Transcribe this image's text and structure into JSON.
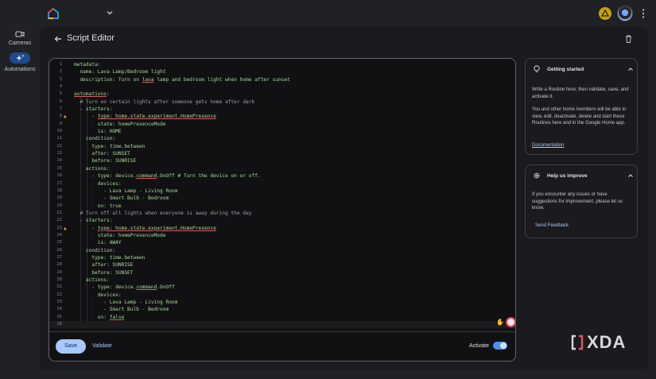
{
  "app": {
    "page_title": "Script Editor"
  },
  "rail": {
    "items": [
      {
        "label": "Cameras",
        "icon": "camera-icon"
      },
      {
        "label": "Automations",
        "icon": "sparkle-icon"
      }
    ]
  },
  "editor": {
    "lines": [
      {
        "n": "1",
        "text": "metadata:"
      },
      {
        "n": "2",
        "text": "  name: Lava Lamp/Bedroom light"
      },
      {
        "n": "3",
        "text": "  description: Turn on |lava| lamp and bedroom light when home after sunset"
      },
      {
        "n": "4",
        "text": ""
      },
      {
        "n": "5",
        "text": "|automations|:"
      },
      {
        "n": "6",
        "text": "  # Turn on certain lights after someone gets home after dark",
        "comment": true
      },
      {
        "n": "7",
        "text": "  - starters:"
      },
      {
        "n": "8",
        "text": "      - |type: home.state.experiment.HomePresence|",
        "warn": true
      },
      {
        "n": "9",
        "text": "        state: homePresenceMode"
      },
      {
        "n": "10",
        "text": "        is: HOME"
      },
      {
        "n": "11",
        "text": "    condition:"
      },
      {
        "n": "12",
        "text": "      type: time.between"
      },
      {
        "n": "13",
        "text": "      after: SUNSET"
      },
      {
        "n": "14",
        "text": "      before: SUNRISE"
      },
      {
        "n": "15",
        "text": "    actions:"
      },
      {
        "n": "16",
        "text": "      - type: device.|command|.OnOff # Turn the device on or off."
      },
      {
        "n": "17",
        "text": "        devices:"
      },
      {
        "n": "18",
        "text": "          - Lava Lamp - Living Room"
      },
      {
        "n": "19",
        "text": "          - Smart Bulb - Bedroom"
      },
      {
        "n": "20",
        "text": "        on: true"
      },
      {
        "n": "21",
        "text": "  # Turn off all lights when everyone is away during the day",
        "comment": true
      },
      {
        "n": "22",
        "text": "  - starters:"
      },
      {
        "n": "23",
        "text": "      - |type: home.state.experiment.HomePresence|",
        "warn": true
      },
      {
        "n": "24",
        "text": "        state: homePresenceMode"
      },
      {
        "n": "25",
        "text": "        is: AWAY"
      },
      {
        "n": "26",
        "text": "    condition:"
      },
      {
        "n": "27",
        "text": "      type: time.between"
      },
      {
        "n": "28",
        "text": "      after: SUNRISE"
      },
      {
        "n": "29",
        "text": "      before: SUNSET"
      },
      {
        "n": "30",
        "text": "    actions:"
      },
      {
        "n": "31",
        "text": "      - type: device.|command|.OnOff"
      },
      {
        "n": "32",
        "text": "        devices:"
      },
      {
        "n": "33",
        "text": "          - Lava Lamp - Living Room"
      },
      {
        "n": "34",
        "text": "          - Smart Bulb - Bedroom"
      },
      {
        "n": "35",
        "text": "        on: |false|"
      },
      {
        "n": "36",
        "text": "",
        "active": true
      }
    ],
    "save_label": "Save",
    "validate_label": "Validate",
    "activate_label": "Activate",
    "activate_on": true
  },
  "getting_started": {
    "title": "Getting started",
    "p1": "Write a Routine here, then validate, save, and activate it.",
    "p2": "You and other home members will be able to view, edit, deactivate, delete and start these Routines here and in the Google Home app.",
    "link": "Documentation"
  },
  "help": {
    "title": "Help us improve",
    "p1": "If you encounter any issues or have suggestions for improvement, please let us know.",
    "link": "Send Feedback"
  },
  "watermark": "XDA",
  "colors": {
    "accent": "#a8c7fa",
    "toggle": "#4c8df6",
    "code_text": "#a8d89a",
    "warning": "#e6b800",
    "error_underline": "#e0555f"
  }
}
